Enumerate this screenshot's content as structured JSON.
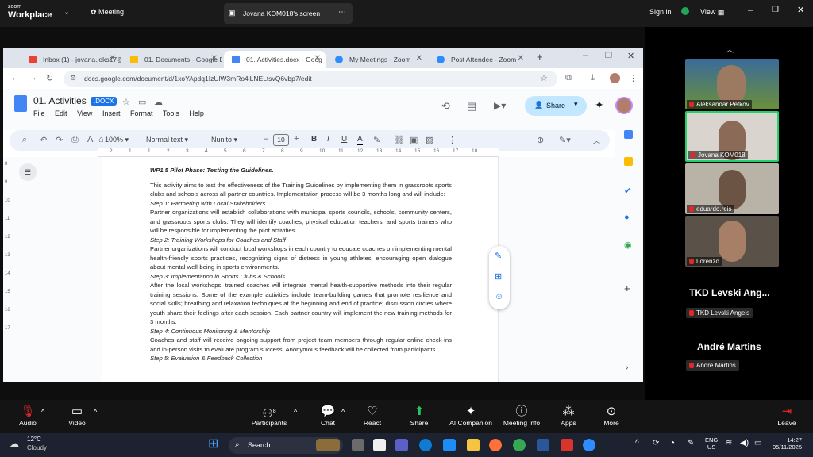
{
  "zoom_top": {
    "brand_line1": "zoom",
    "brand_line2": "Workplace",
    "meeting_label": "Meeting",
    "share_title": "Jovana KOM018's screen",
    "sign_in": "Sign in",
    "view": "View"
  },
  "browser": {
    "tabs": [
      {
        "label": "Inbox (1) - jovana.joks17@",
        "color": "#ea4335"
      },
      {
        "label": "01. Documents - Google Dri",
        "color": "#fbbc04"
      },
      {
        "label": "01. Activities.docx - Goog",
        "color": "#4285f4"
      },
      {
        "label": "My Meetings - Zoom",
        "color": "#2d8cff"
      },
      {
        "label": "Post Attendee - Zoom",
        "color": "#2d8cff"
      }
    ],
    "url": "docs.google.com/document/d/1xoYApdq1IzUlW3mRo4lLNELtsvQ6vbp7/edit"
  },
  "docs": {
    "title": "01. Activities",
    "badge": ".DOCX",
    "menu": [
      "File",
      "Edit",
      "View",
      "Insert",
      "Format",
      "Tools",
      "Help"
    ],
    "share_label": "Share",
    "zoom_level": "100%",
    "style": "Normal text",
    "font": "Nunito",
    "font_size": "10",
    "ruler_ticks": [
      "2",
      "1",
      "1",
      "2",
      "3",
      "4",
      "5",
      "6",
      "7",
      "8",
      "9",
      "10",
      "11",
      "12",
      "13",
      "14",
      "15",
      "16",
      "17",
      "18"
    ],
    "left_ruler": [
      "8",
      "9",
      "10",
      "11",
      "12",
      "13",
      "14",
      "15",
      "16",
      "17"
    ]
  },
  "document": {
    "heading": "WP1.5 Pilot Phase: Testing the Guidelines.",
    "intro": "This activity aims to test the effectiveness of the Training Guidelines by implementing them in grassroots sports clubs and schools across all partner countries. Implementation process will be 3 months long and will include:",
    "steps": [
      {
        "title": "Step 1: Partnering with Local Stakeholders",
        "text": "Partner organizations will establish collaborations with municipal sports councils, schools, community centers, and grassroots sports clubs. They will identify coaches, physical education teachers, and sports trainers who will be responsible for implementing the pilot activities."
      },
      {
        "title": "Step 2: Training Workshops for Coaches and Staff",
        "text": "Partner organizations will conduct local workshops in each country to educate coaches on implementing mental health-friendly sports practices, recognizing signs of distress in young athletes, encouraging open dialogue about mental well-being in sports environments."
      },
      {
        "title": "Step 3: Implementation in Sports Clubs & Schools",
        "text": "After the local workshops, trained coaches will integrate mental health-supportive methods into their regular training sessions. Some of the example activities include team-building games that promote resilience and social skills; breathing and relaxation techniques at the beginning and end of practice; discussion circles where youth share their feelings after each session. Each partner country will implement the new training methods for 3 months."
      },
      {
        "title": "Step 4: Continuous Monitoring & Mentorship",
        "text": "Coaches and staff will receive ongoing support from project team members through regular online check-ins and in-person visits to evaluate program success. Anonymous feedback will be collected from participants."
      },
      {
        "title": "Step 5: Evaluation & Feedback Collection",
        "text": ""
      }
    ]
  },
  "participants": {
    "videos": [
      {
        "name": "Aleksandar Petkov"
      },
      {
        "name": "Jovana KOM018"
      },
      {
        "name": "eduardo.reis"
      },
      {
        "name": "Lorenzo"
      }
    ],
    "tiles": [
      {
        "title": "TKD Levski Ang...",
        "name": "TKD Levski Angels"
      },
      {
        "title": "André Martins",
        "name": "André Martins"
      }
    ]
  },
  "zoom_bottom": {
    "audio": "Audio",
    "video": "Video",
    "participants": "Participants",
    "participant_count": "8",
    "chat": "Chat",
    "react": "React",
    "share": "Share",
    "ai": "AI Companion",
    "info": "Meeting info",
    "apps": "Apps",
    "more": "More",
    "leave": "Leave"
  },
  "taskbar": {
    "temp": "12°C",
    "weather": "Cloudy",
    "search": "Search",
    "lang1": "ENG",
    "lang2": "US",
    "time": "14:27",
    "date": "05/11/2025"
  }
}
